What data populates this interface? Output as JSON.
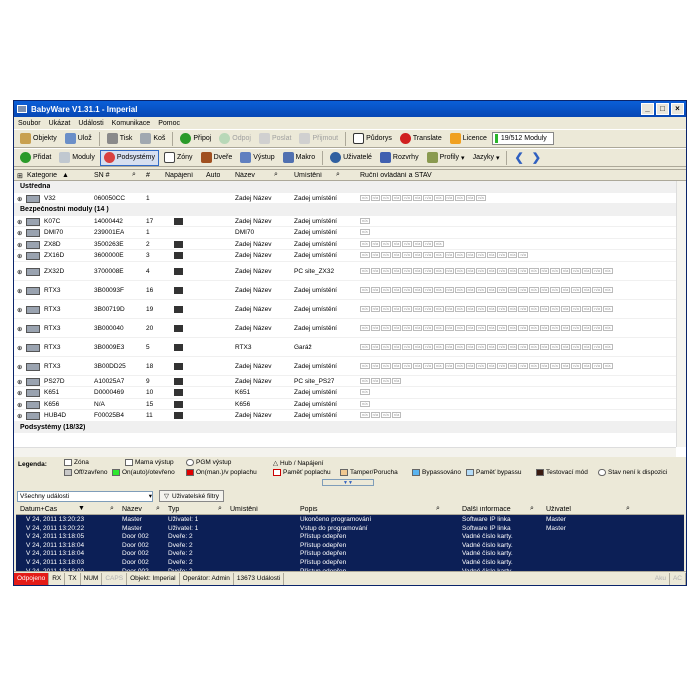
{
  "window": {
    "title": "BabyWare V1.31.1 - Imperial"
  },
  "menu": [
    "Soubor",
    "Ukázat",
    "Události",
    "Komunikace",
    "Pomoc"
  ],
  "toolbar1": {
    "objects": "Objekty",
    "save": "Ulož",
    "print": "Tisk",
    "trash": "Koš",
    "connect": "Připoj",
    "disconnect": "Odpoj",
    "send": "Poslat",
    "receive": "Přijmout",
    "floorplan": "Půdorys",
    "translate": "Translate",
    "license": "Licence",
    "modules": "19/512 Moduly"
  },
  "toolbar2": {
    "add": "Přidat",
    "modules": "Moduly",
    "subsystems": "Podsystémy",
    "zones": "Zóny",
    "doors": "Dveře",
    "output": "Výstup",
    "macro": "Makro",
    "users": "Uživatelé",
    "schedules": "Rozvrhy",
    "profiles": "Profily",
    "languages": "Jazyky"
  },
  "grid": {
    "headers": {
      "category": "Kategorie",
      "sn": "SN #",
      "num": "#",
      "power": "Napájení",
      "auto": "Auto",
      "name": "Název",
      "location": "Umístění",
      "manual": "Ruční ovládání a STAV"
    },
    "rows": [
      {
        "type": "group",
        "label": "Ústředna"
      },
      {
        "type": "item",
        "cat": "V32",
        "sn": "060050CC",
        "num": "1",
        "power": "",
        "name": "Zadej Název",
        "loc": "Zadej umístění",
        "boxes": 12,
        "tall": false
      },
      {
        "type": "group",
        "label": "Bezpečnostní moduly  (14 )"
      },
      {
        "type": "item",
        "cat": "K07C",
        "sn": "14000442",
        "num": "17",
        "power": "y",
        "name": "Zadej Název",
        "loc": "Zadej umístění",
        "boxes": 1,
        "tall": false
      },
      {
        "type": "item",
        "cat": "DMI70",
        "sn": "239001EA",
        "num": "1",
        "power": "",
        "name": "DMI70",
        "loc": "Zadej umístění",
        "boxes": 1,
        "tall": false
      },
      {
        "type": "item",
        "cat": "ZX8D",
        "sn": "3500263E",
        "num": "2",
        "power": "y",
        "name": "Zadej Název",
        "loc": "Zadej umístění",
        "boxes": 8,
        "tall": false
      },
      {
        "type": "item",
        "cat": "ZX16D",
        "sn": "3600000E",
        "num": "3",
        "power": "y",
        "name": "Zadej Název",
        "loc": "Zadej umístění",
        "boxes": 16,
        "tall": false
      },
      {
        "type": "item",
        "cat": "ZX32D",
        "sn": "3700008E",
        "num": "4",
        "power": "y",
        "name": "Zadej Název",
        "loc": "PC site_ZX32",
        "boxes": 24,
        "tall": true
      },
      {
        "type": "item",
        "cat": "RTX3",
        "sn": "3B00093F",
        "num": "16",
        "power": "y",
        "name": "Zadej Název",
        "loc": "Zadej umístění",
        "boxes": 24,
        "tall": true
      },
      {
        "type": "item",
        "cat": "RTX3",
        "sn": "3B00719D",
        "num": "19",
        "power": "y",
        "name": "Zadej Název",
        "loc": "Zadej umístění",
        "boxes": 24,
        "tall": true
      },
      {
        "type": "item",
        "cat": "RTX3",
        "sn": "3B000040",
        "num": "20",
        "power": "y",
        "name": "Zadej Název",
        "loc": "Zadej umístění",
        "boxes": 24,
        "tall": true
      },
      {
        "type": "item",
        "cat": "RTX3",
        "sn": "3B0009E3",
        "num": "5",
        "power": "y",
        "name": "RTX3",
        "loc": "Garáž",
        "boxes": 24,
        "tall": true
      },
      {
        "type": "item",
        "cat": "RTX3",
        "sn": "3B00DD25",
        "num": "18",
        "power": "y",
        "name": "Zadej Název",
        "loc": "Zadej umístění",
        "boxes": 24,
        "tall": true
      },
      {
        "type": "item",
        "cat": "PS27D",
        "sn": "A10025A7",
        "num": "9",
        "power": "y",
        "name": "Zadej Název",
        "loc": "PC site_PS27",
        "boxes": 4,
        "tall": false
      },
      {
        "type": "item",
        "cat": "K651",
        "sn": "D0000469",
        "num": "10",
        "power": "y",
        "name": "K651",
        "loc": "Zadej umístění",
        "boxes": 1,
        "tall": false
      },
      {
        "type": "item",
        "cat": "K656",
        "sn": "N/A",
        "num": "15",
        "power": "y",
        "name": "K656",
        "loc": "Zadej umístění",
        "boxes": 1,
        "tall": false
      },
      {
        "type": "item",
        "cat": "HUB4D",
        "sn": "F00025B4",
        "num": "11",
        "power": "y",
        "name": "Zadej Název",
        "loc": "Zadej umístění",
        "boxes": 4,
        "tall": false
      },
      {
        "type": "group",
        "label": "Podsystémy (18/32)"
      }
    ]
  },
  "legend": {
    "title": "Legenda:",
    "zone": "Zóna",
    "pgm_out": "Mama výstup",
    "pgm": "PGM výstup",
    "hub": "Hub / Napájení",
    "off": "Off/zavřeno",
    "on_auto": "On(auto)/otevřeno",
    "on_man": "On(man.)/v poplachu",
    "alarm_mem": "Paměť poplachu",
    "tamper": "Tamper/Porucha",
    "bypassed": "Bypassováno",
    "bypass_mem": "Paměť bypassu",
    "test": "Testovací mód",
    "unavailable": "Stav není k dispozici",
    "colors": {
      "off": "#c8c8c8",
      "on_auto": "#2ee82e",
      "on_man": "#e00000",
      "tamper": "#f0c890",
      "bypassed": "#5ab4f0",
      "bypass_mem": "#b4dcf8",
      "test": "#3a1a10"
    }
  },
  "filter": {
    "select": "Všechny události",
    "user_filters": "Uživatelské filtry"
  },
  "events": {
    "headers": {
      "datetime": "Datum+Čas",
      "name": "Název",
      "type": "Typ",
      "location": "Umístění",
      "desc": "Popis",
      "more": "Další informace",
      "user": "Uživatel"
    },
    "rows": [
      {
        "dt": "V 24, 2011   13:20:23",
        "name": "Master",
        "type": "Uživatel: 1",
        "loc": "",
        "desc": "Ukončeno programování",
        "more": "Software IP linka",
        "user": "Master"
      },
      {
        "dt": "V 24, 2011   13:20:22",
        "name": "Master",
        "type": "Uživatel: 1",
        "loc": "",
        "desc": "Vstup do programování",
        "more": "Software IP linka",
        "user": "Master"
      },
      {
        "dt": "V 24, 2011   13:18:05",
        "name": "Door 002",
        "type": "Dveře: 2",
        "loc": "",
        "desc": "Přístup odepřen",
        "more": "Vadné číslo karty.",
        "user": ""
      },
      {
        "dt": "V 24, 2011   13:18:04",
        "name": "Door 002",
        "type": "Dveře: 2",
        "loc": "",
        "desc": "Přístup odepřen",
        "more": "Vadné číslo karty.",
        "user": ""
      },
      {
        "dt": "V 24, 2011   13:18:04",
        "name": "Door 002",
        "type": "Dveře: 2",
        "loc": "",
        "desc": "Přístup odepřen",
        "more": "Vadné číslo karty.",
        "user": ""
      },
      {
        "dt": "V 24, 2011   13:18:03",
        "name": "Door 002",
        "type": "Dveře: 2",
        "loc": "",
        "desc": "Přístup odepřen",
        "more": "Vadné číslo karty.",
        "user": ""
      },
      {
        "dt": "V 24, 2011   13:18:00",
        "name": "Door 002",
        "type": "Dveře: 2",
        "loc": "",
        "desc": "Přístup odepřen",
        "more": "Vadné číslo karty.",
        "user": ""
      }
    ]
  },
  "statusbar": {
    "disconnected": "Odpojeno",
    "rx": "RX",
    "tx": "TX",
    "num": "NUM",
    "caps": "CAPS",
    "object": "Objekt: Imperial",
    "operator": "Operátor: Admin",
    "events": "13673 Události",
    "aku": "Aku",
    "ac": "AC"
  }
}
